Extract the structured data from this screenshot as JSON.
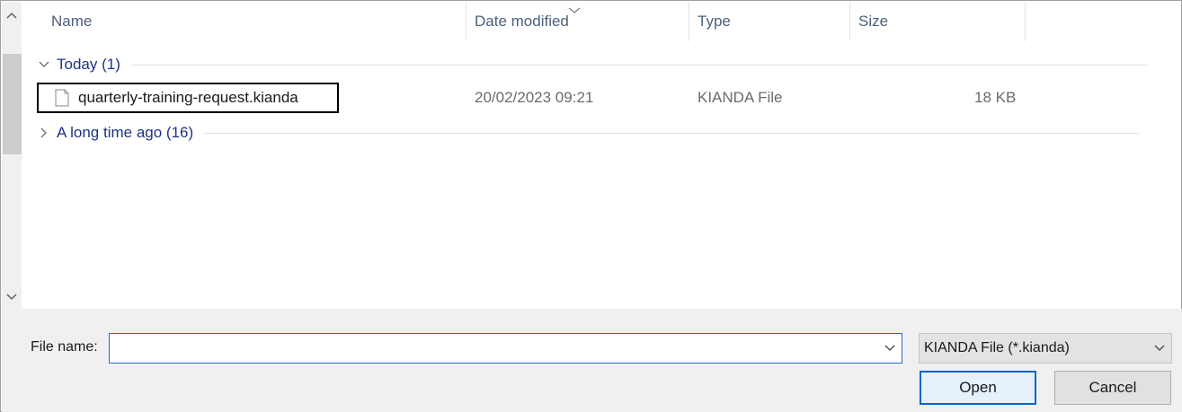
{
  "columns": {
    "name": "Name",
    "date_modified": "Date modified",
    "type": "Type",
    "size": "Size"
  },
  "groups": {
    "today": "Today (1)",
    "long_ago": "A long time ago (16)"
  },
  "files": [
    {
      "name": "quarterly-training-request.kianda",
      "date_modified": "20/02/2023 09:21",
      "type": "KIANDA File",
      "size": "18 KB",
      "icon": "document-icon"
    }
  ],
  "file_name": {
    "label": "File name:",
    "value": ""
  },
  "file_type": {
    "selected": "KIANDA File (*.kianda)"
  },
  "buttons": {
    "open": "Open",
    "cancel": "Cancel"
  },
  "colors": {
    "group_text": "#1e3287",
    "header_text": "#4c607a",
    "focus_border": "#1f6fd1",
    "panel_bg": "#f0f0f0"
  }
}
